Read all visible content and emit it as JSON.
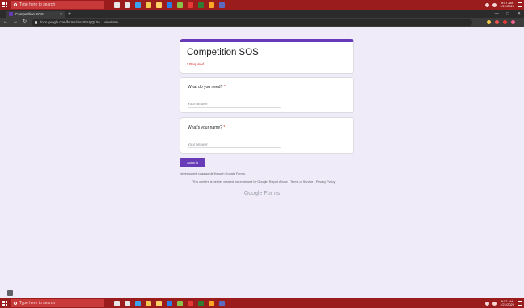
{
  "taskbar": {
    "search_placeholder": "Type here to search",
    "time": "9:57 AM",
    "date": "1/21/2020",
    "apps": [
      "#e8e8e8",
      "#e8e8e8",
      "#3aa0f0",
      "#f2c94c",
      "#ffd166",
      "#2b7de9",
      "#8bc34a",
      "#e53935",
      "#2e7d32",
      "#f9a825",
      "#5c6bc0"
    ]
  },
  "browser": {
    "tab_title": "Competition SOS",
    "url": "docs.google.com/forms/d/e/1FAIpQLSe.../viewform",
    "extensions": [
      "#f2c94c",
      "#ef5350",
      "#e53935",
      "#f06292"
    ]
  },
  "form": {
    "title": "Competition SOS",
    "required_note": "* Required",
    "questions": [
      {
        "label": "What do you need?",
        "star": "*",
        "placeholder": "Your answer"
      },
      {
        "label": "What's your name?",
        "star": "*",
        "placeholder": "Your answer"
      }
    ],
    "submit_label": "Submit",
    "password_note": "Never submit passwords through Google Forms.",
    "disclaimer": "This content is neither created nor endorsed by Google. Report Abuse - Terms of Service - Privacy Policy",
    "brand": "Google Forms"
  },
  "colors": {
    "accent": "#673ab7",
    "page_background": "#f0ebf8",
    "taskbar": "#9b1c1c",
    "required": "#d93025"
  }
}
